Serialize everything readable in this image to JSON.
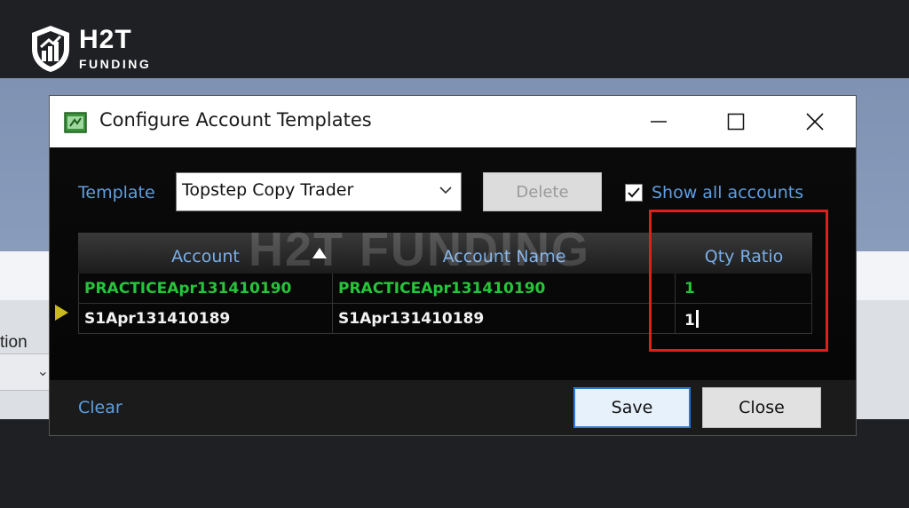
{
  "logo": {
    "title": "H2T",
    "subtitle": "FUNDING"
  },
  "background": {
    "partial_label": "tion"
  },
  "dialog": {
    "title": "Configure Account Templates",
    "template_label": "Template",
    "template_value": "Topstep Copy Trader",
    "delete_label": "Delete",
    "show_all_label": "Show all accounts",
    "show_all_checked": true,
    "watermark": "H2T FUNDING",
    "columns": [
      "Account",
      "Account Name",
      "Qty Ratio"
    ],
    "rows": [
      {
        "account": "PRACTICEApr131410190",
        "account_name": "PRACTICEApr131410190",
        "qty_ratio": "1",
        "color": "#26c53a"
      },
      {
        "account": "S1Apr131410189",
        "account_name": "S1Apr131410189",
        "qty_ratio": "1",
        "color": "#f2f2f2"
      }
    ],
    "clear_label": "Clear",
    "save_label": "Save",
    "close_label": "Close"
  },
  "colors": {
    "link_blue": "#5f9ee0",
    "highlight_red": "#e31c1c",
    "green_text": "#26c53a"
  },
  "icons": [
    "logo-shield-icon",
    "app-icon",
    "minimize-icon",
    "maximize-icon",
    "close-icon",
    "chevron-down-icon",
    "checkmark-icon",
    "sort-up-icon",
    "row-indicator-icon"
  ]
}
